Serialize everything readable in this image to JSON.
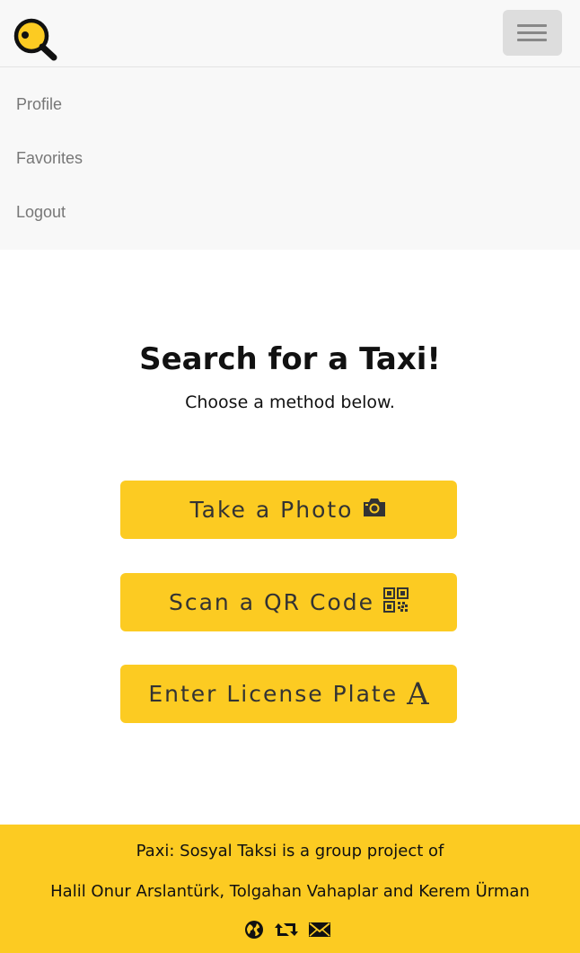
{
  "nav": {
    "logo_icon": "magnifier-logo-icon",
    "menu_icon": "hamburger-menu-icon",
    "items": [
      {
        "label": "Profile"
      },
      {
        "label": "Favorites"
      },
      {
        "label": "Logout"
      }
    ]
  },
  "hero": {
    "title": "Search for a Taxi!",
    "subtitle": "Choose a method below."
  },
  "buttons": {
    "photo": {
      "label": "Take a Photo",
      "icon": "camera-icon"
    },
    "qr": {
      "label": "Scan a QR Code",
      "icon": "qr-code-icon"
    },
    "plate": {
      "label": "Enter License Plate",
      "icon": "letter-a-icon",
      "icon_text": "A"
    }
  },
  "footer": {
    "line1": "Paxi: Sosyal Taksi is a group project of",
    "line2": "Halil Onur Arslantürk, Tolgahan Vahaplar and Kerem Ürman",
    "icons": [
      "globe-icon",
      "retweet-icon",
      "envelope-icon"
    ]
  },
  "colors": {
    "accent": "#fccb22",
    "navbar_bg": "#f8f8f8",
    "nav_text": "#777777",
    "button_text": "#333333"
  }
}
